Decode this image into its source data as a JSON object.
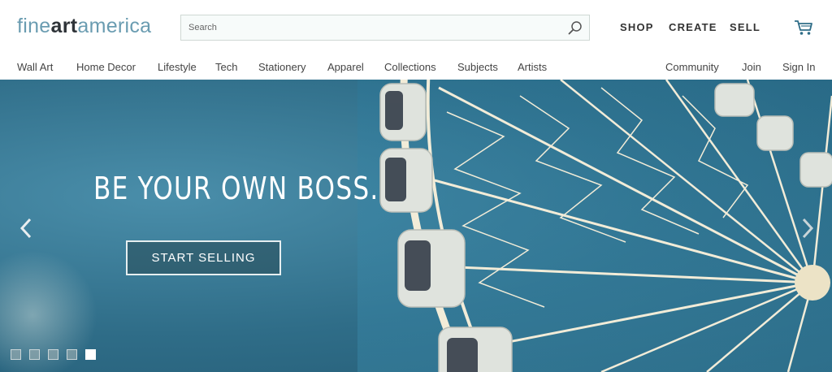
{
  "brand": {
    "logo_part1": "fine",
    "logo_part2": "art",
    "logo_part3": "america"
  },
  "search": {
    "placeholder": "Search"
  },
  "top_nav": {
    "shop": "SHOP",
    "create": "CREATE",
    "sell": "SELL"
  },
  "category_nav": {
    "items": [
      "Wall Art",
      "Home Decor",
      "Lifestyle",
      "Tech",
      "Stationery",
      "Apparel",
      "Collections",
      "Subjects",
      "Artists"
    ],
    "right": [
      "Community",
      "Join",
      "Sign In"
    ]
  },
  "hero": {
    "title": "BE YOUR OWN BOSS.",
    "button": "START SELLING",
    "slides_total": 5,
    "active_slide": 5
  },
  "colors": {
    "logo_light": "#6a9cb1",
    "logo_dark": "#2e3338",
    "hero_sky": "#2f6d88"
  },
  "icons": {
    "search": "search-icon",
    "cart": "cart-icon",
    "prev": "chevron-left-icon",
    "next": "chevron-right-icon"
  }
}
